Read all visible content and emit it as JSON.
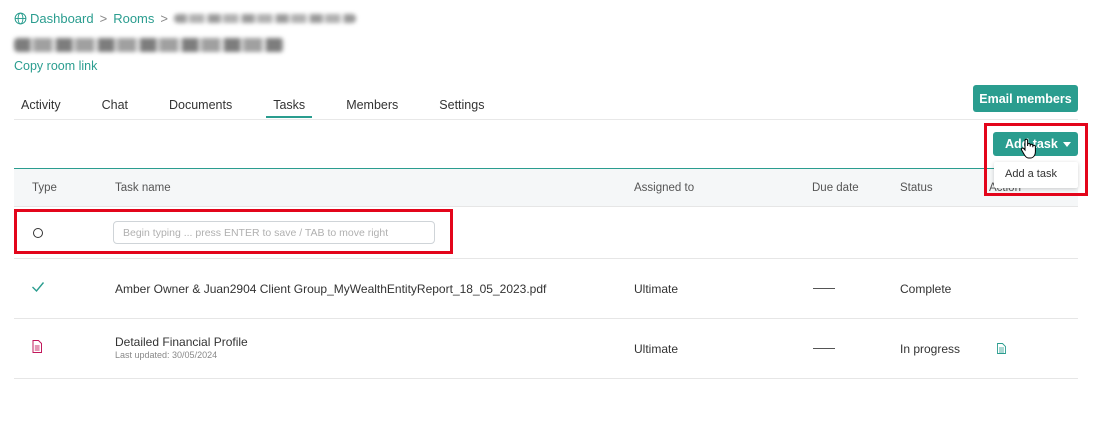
{
  "breadcrumb": {
    "dashboard": "Dashboard",
    "sep1": ">",
    "rooms": "Rooms",
    "sep2": ">"
  },
  "copy_link": "Copy room link",
  "tabs": [
    {
      "label": "Activity"
    },
    {
      "label": "Chat"
    },
    {
      "label": "Documents"
    },
    {
      "label": "Tasks"
    },
    {
      "label": "Members"
    },
    {
      "label": "Settings"
    }
  ],
  "buttons": {
    "email_members": "Email members",
    "add_task": "Add task"
  },
  "dropdown": {
    "add_a_task": "Add a task"
  },
  "table": {
    "headers": {
      "type": "Type",
      "task_name": "Task name",
      "assigned_to": "Assigned to",
      "due_date": "Due date",
      "status": "Status",
      "action": "Action"
    },
    "new_row": {
      "placeholder": "Begin typing ... press ENTER to save / TAB to move right"
    },
    "rows": [
      {
        "name": "Amber Owner & Juan2904 Client Group_MyWealthEntityReport_18_05_2023.pdf",
        "assigned": "Ultimate",
        "status": "Complete"
      },
      {
        "name": "Detailed Financial Profile",
        "updated": "Last updated: 30/05/2024",
        "assigned": "Ultimate",
        "status": "In progress"
      }
    ]
  },
  "colors": {
    "accent": "#2a9d8f",
    "highlight": "#e3051b",
    "doc_icon": "#c2185b"
  }
}
